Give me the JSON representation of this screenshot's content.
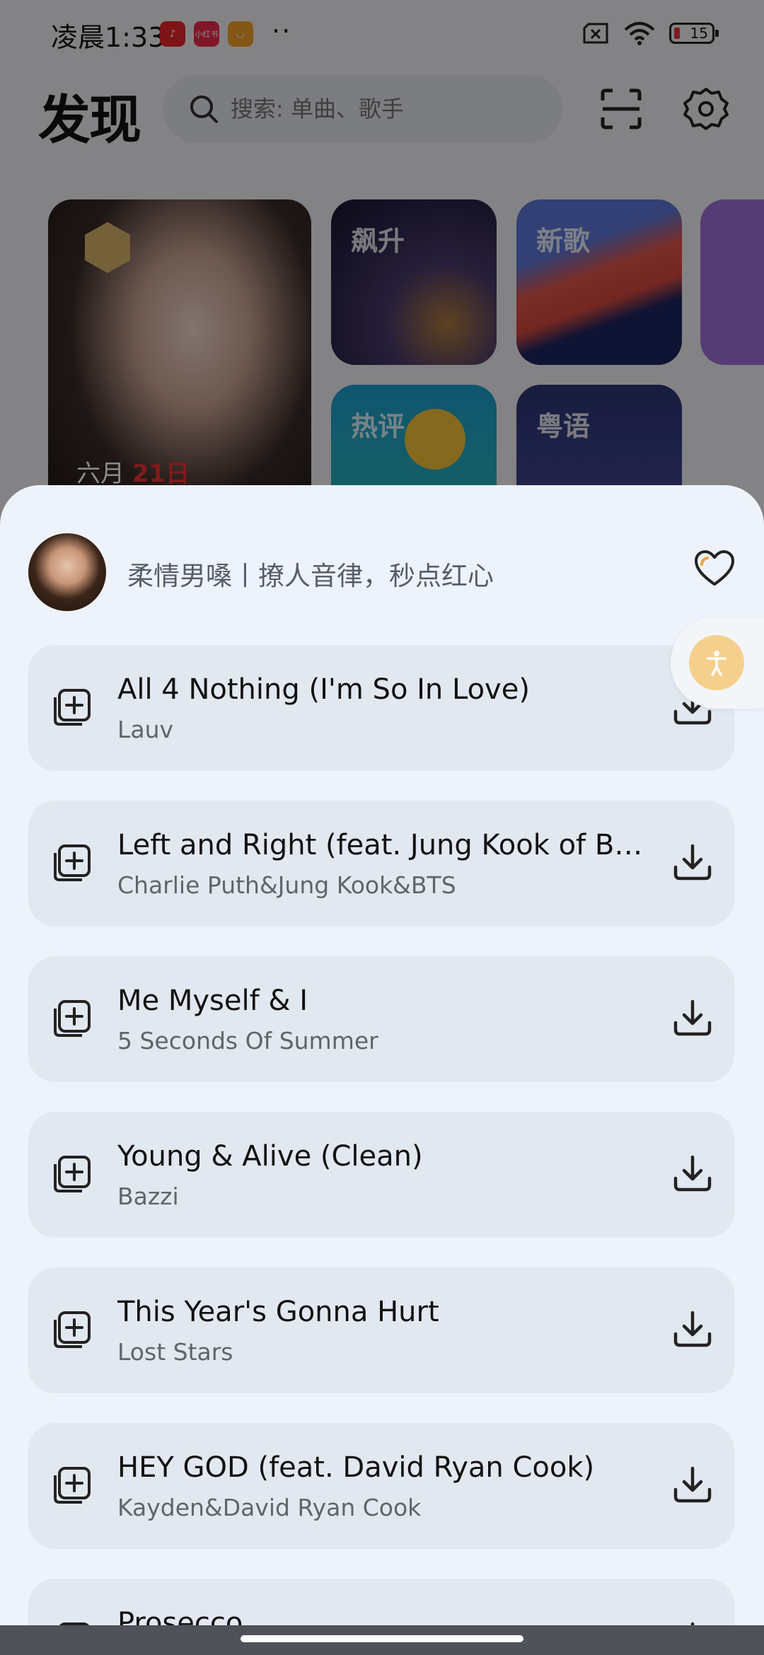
{
  "status": {
    "time": "凌晨1:33",
    "dots": "··",
    "battery": "15",
    "app_icons": [
      {
        "name": "music-app-icon",
        "glyph": "♪",
        "color": "#e8282b"
      },
      {
        "name": "xiaohongshu-icon",
        "glyph": "小红书",
        "color": "#ee2a4a"
      },
      {
        "name": "taobao-icon",
        "glyph": "◡",
        "color": "#f4a22a"
      }
    ]
  },
  "header": {
    "title": "发现",
    "search_placeholder": "搜索: 单曲、歌手"
  },
  "cards": {
    "date_prefix": "六月",
    "date_day": "21日",
    "labels": [
      "飙升",
      "新歌",
      "热评",
      "粤语"
    ]
  },
  "playlist": {
    "title": "柔情男嗓丨撩人音律，秒点红心"
  },
  "songs": [
    {
      "title": "All 4 Nothing (I'm So In Love)",
      "artist": "Lauv"
    },
    {
      "title": "Left and Right (feat. Jung Kook of BTS)",
      "artist": "Charlie Puth&Jung Kook&BTS"
    },
    {
      "title": "Me Myself & I",
      "artist": "5 Seconds Of Summer"
    },
    {
      "title": "Young & Alive (Clean)",
      "artist": "Bazzi"
    },
    {
      "title": "This Year's Gonna Hurt",
      "artist": "Lost Stars"
    },
    {
      "title": "HEY GOD (feat. David Ryan Cook)",
      "artist": "Kayden&David Ryan Cook"
    },
    {
      "title": "Prosecco",
      "artist": ""
    }
  ]
}
